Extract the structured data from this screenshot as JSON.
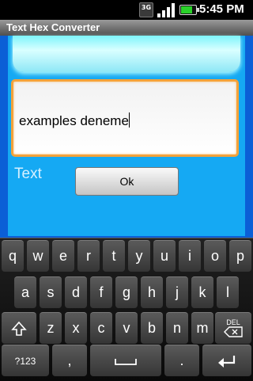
{
  "status_bar": {
    "network_label": "3G",
    "time": "5:45 PM",
    "signal_level": 0.9,
    "battery_level": 0.85,
    "icons": [
      "3g-network-icon",
      "signal-strength-icon",
      "battery-icon"
    ]
  },
  "app": {
    "title": "Text Hex Converter",
    "input_value": "examples deneme",
    "output_label": "Text",
    "ok_label": "Ok"
  },
  "keyboard": {
    "row1": [
      "q",
      "w",
      "e",
      "r",
      "t",
      "y",
      "u",
      "i",
      "o",
      "p"
    ],
    "row2": [
      "a",
      "s",
      "d",
      "f",
      "g",
      "h",
      "j",
      "k",
      "l"
    ],
    "row3": [
      "z",
      "x",
      "c",
      "v",
      "b",
      "n",
      "m"
    ],
    "shift_icon": "shift-icon",
    "del_label": "DEL",
    "symbols_label": "?123",
    "comma_label": ",",
    "period_label": ".",
    "space_icon": "space-icon",
    "enter_icon": "enter-icon"
  },
  "colors": {
    "app_background": "#15a9f3",
    "app_frame": "#0b5fd6",
    "input_border": "#f4a23a",
    "output_label": "#d6f0ff"
  }
}
